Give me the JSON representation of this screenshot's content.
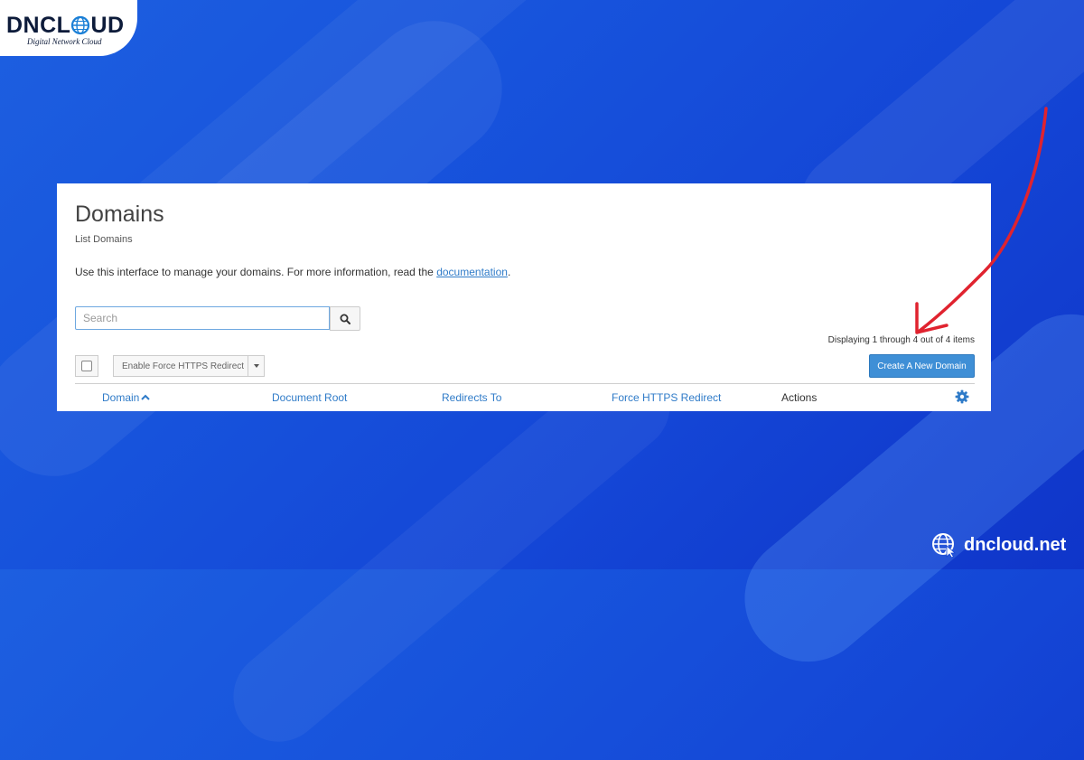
{
  "brand": {
    "logo_text": "DNCL",
    "logo_text_tail": "UD",
    "tagline": "Digital Network Cloud",
    "site_url": "dncloud.net"
  },
  "page": {
    "title": "Domains",
    "subtitle": "List Domains",
    "intro_text": "Use this interface to manage your domains. For more information, read the ",
    "intro_link": "documentation",
    "intro_end": "."
  },
  "search": {
    "placeholder": "Search",
    "value": ""
  },
  "list": {
    "displaying": "Displaying 1 through 4 out of 4 items"
  },
  "toolbar": {
    "force_https_label": "Enable Force HTTPS Redirect",
    "create_label": "Create A New Domain"
  },
  "table": {
    "columns": [
      "Domain",
      "Document Root",
      "Redirects To",
      "Force HTTPS Redirect",
      "Actions"
    ]
  },
  "icons": {
    "search": "search-icon",
    "sort": "chevron-up-icon",
    "settings": "gear-icon",
    "globe": "globe-icon",
    "annotation": "red-arrow"
  },
  "colors": {
    "accent": "#3f8fd6",
    "link": "#2f7bc8",
    "annotation": "#e0232f",
    "background": "#1753dc"
  }
}
